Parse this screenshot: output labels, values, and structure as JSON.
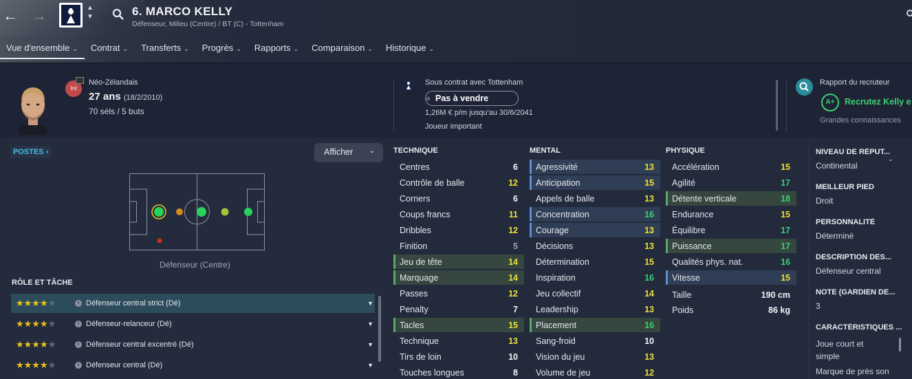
{
  "header": {
    "player_name": "6. MARCO KELLY",
    "subtitle": "Défenseur, Milieu (Centre) / BT (C) - Tottenham",
    "icons": [
      "back-arrow-icon",
      "forward-arrow-icon",
      "club-crest-icon",
      "search-icon"
    ]
  },
  "tabs": [
    {
      "label": "Vue d'ensemble",
      "active": true
    },
    {
      "label": "Contrat"
    },
    {
      "label": "Transferts"
    },
    {
      "label": "Progrès"
    },
    {
      "label": "Rapports"
    },
    {
      "label": "Comparaison"
    },
    {
      "label": "Historique"
    }
  ],
  "profile": {
    "int_badge": "Int",
    "nationality": "Néo-Zélandais",
    "age": "27 ans",
    "dob": "(18/2/2010)",
    "caps": "70 séls / 5 buts"
  },
  "contract": {
    "with": "Sous contrat avec Tottenham",
    "transfer_status": "Pas à vendre",
    "wage": "1,26M € p/m jusqu'au 30/6/2041",
    "squad_status": "Joueur important"
  },
  "scout": {
    "title": "Rapport du recruteur",
    "grade": "A+",
    "recommendation": "Recrutez Kelly e",
    "knowledge": "Grandes connaissances"
  },
  "positions": {
    "title": "POSTES",
    "show_button": "Afficher",
    "position_label": "Défenseur (Centre)",
    "colors": {
      "natural": "#27d35a",
      "accomplished": "#a6c53a",
      "unconvincing": "#d88a1a",
      "awkward": "#cc3311",
      "ring": "#f0c419"
    }
  },
  "roles": {
    "title": "RÔLE ET TÂCHE",
    "items": [
      {
        "label": "Défenseur central strict (Dé)",
        "stars": 4,
        "selected": true
      },
      {
        "label": "Défenseur-relanceur (Dé)",
        "stars": 4
      },
      {
        "label": "Défenseur central excentré (Dé)",
        "stars": 4
      },
      {
        "label": "Défenseur central (Dé)",
        "stars": 4
      }
    ]
  },
  "technique": {
    "title": "TECHNIQUE",
    "items": [
      {
        "name": "Centres",
        "value": "6",
        "hl": ""
      },
      {
        "name": "Contrôle de balle",
        "value": "12",
        "hl": ""
      },
      {
        "name": "Corners",
        "value": "6",
        "hl": ""
      },
      {
        "name": "Coups francs",
        "value": "11",
        "hl": ""
      },
      {
        "name": "Dribbles",
        "value": "12",
        "hl": ""
      },
      {
        "name": "Finition",
        "value": "5",
        "hl": ""
      },
      {
        "name": "Jeu de tête",
        "value": "14",
        "hl": "g"
      },
      {
        "name": "Marquage",
        "value": "14",
        "hl": "g"
      },
      {
        "name": "Passes",
        "value": "12",
        "hl": ""
      },
      {
        "name": "Penalty",
        "value": "7",
        "hl": ""
      },
      {
        "name": "Tacles",
        "value": "15",
        "hl": "g"
      },
      {
        "name": "Technique",
        "value": "13",
        "hl": ""
      },
      {
        "name": "Tirs de loin",
        "value": "10",
        "hl": ""
      },
      {
        "name": "Touches longues",
        "value": "8",
        "hl": ""
      }
    ]
  },
  "mental": {
    "title": "MENTAL",
    "items": [
      {
        "name": "Agressivité",
        "value": "13",
        "hl": "b"
      },
      {
        "name": "Anticipation",
        "value": "15",
        "hl": "b"
      },
      {
        "name": "Appels de balle",
        "value": "13",
        "hl": ""
      },
      {
        "name": "Concentration",
        "value": "16",
        "hl": "b"
      },
      {
        "name": "Courage",
        "value": "13",
        "hl": "b"
      },
      {
        "name": "Décisions",
        "value": "13",
        "hl": ""
      },
      {
        "name": "Détermination",
        "value": "15",
        "hl": ""
      },
      {
        "name": "Inspiration",
        "value": "16",
        "hl": ""
      },
      {
        "name": "Jeu collectif",
        "value": "14",
        "hl": ""
      },
      {
        "name": "Leadership",
        "value": "13",
        "hl": ""
      },
      {
        "name": "Placement",
        "value": "16",
        "hl": "g"
      },
      {
        "name": "Sang-froid",
        "value": "10",
        "hl": ""
      },
      {
        "name": "Vision du jeu",
        "value": "13",
        "hl": ""
      },
      {
        "name": "Volume de jeu",
        "value": "12",
        "hl": ""
      }
    ]
  },
  "physique": {
    "title": "PHYSIQUE",
    "items": [
      {
        "name": "Accélération",
        "value": "15",
        "hl": ""
      },
      {
        "name": "Agilité",
        "value": "17",
        "hl": ""
      },
      {
        "name": "Détente verticale",
        "value": "18",
        "hl": "g"
      },
      {
        "name": "Endurance",
        "value": "15",
        "hl": ""
      },
      {
        "name": "Équilibre",
        "value": "17",
        "hl": ""
      },
      {
        "name": "Puissance",
        "value": "17",
        "hl": "g"
      },
      {
        "name": "Qualités phys. nat.",
        "value": "16",
        "hl": ""
      },
      {
        "name": "Vitesse",
        "value": "15",
        "hl": "b"
      }
    ],
    "height_label": "Taille",
    "height": "190 cm",
    "weight_label": "Poids",
    "weight": "86 kg"
  },
  "right_panel": {
    "items": [
      {
        "title": "NIVEAU DE RÉPUT...",
        "value": "Continental"
      },
      {
        "title": "MEILLEUR PIED",
        "value": "Droit"
      },
      {
        "title": "PERSONNALITÉ",
        "value": "Déterminé"
      },
      {
        "title": "DESCRIPTION DES...",
        "value": "Défenseur central"
      },
      {
        "title": "NOTE (GARDIEN DE...",
        "value": "3"
      },
      {
        "title": "CARACTÉRISTIQUES ...",
        "value": "Joue court et"
      }
    ],
    "extra_line1": "simple",
    "extra_line2": "Marque de près son"
  }
}
